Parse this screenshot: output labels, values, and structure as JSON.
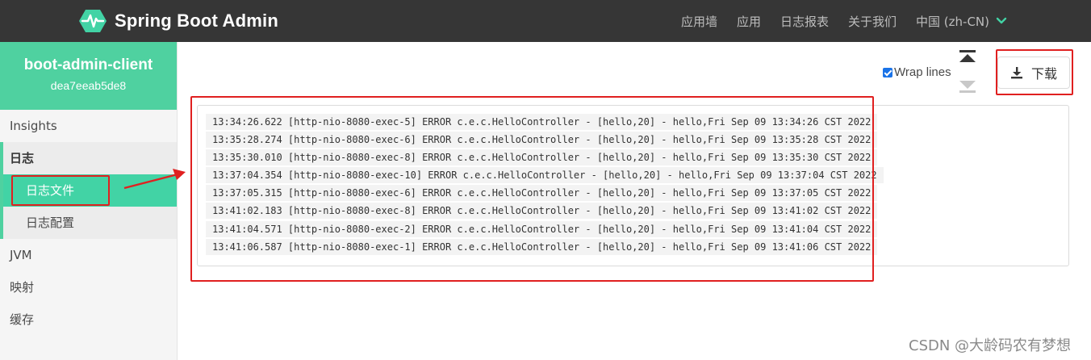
{
  "navbar": {
    "brand": "Spring Boot Admin",
    "items": [
      "应用墙",
      "应用",
      "日志报表",
      "关于我们"
    ],
    "language": "中国 (zh-CN)",
    "accent": "#4fd1a0"
  },
  "sidebar": {
    "app_name": "boot-admin-client",
    "app_id": "dea7eeab5de8",
    "items": {
      "insights": "Insights",
      "log_group": "日志",
      "log_file": "日志文件",
      "log_config": "日志配置",
      "jvm": "JVM",
      "mapping": "映射",
      "cache": "缓存"
    }
  },
  "toolbar": {
    "wrap_lines_label": "Wrap lines",
    "wrap_lines_checked": true,
    "download_label": "下载"
  },
  "log": {
    "lines": [
      "13:34:26.622 [http-nio-8080-exec-5] ERROR c.e.c.HelloController - [hello,20] - hello,Fri Sep 09 13:34:26 CST 2022",
      "13:35:28.274 [http-nio-8080-exec-6] ERROR c.e.c.HelloController - [hello,20] - hello,Fri Sep 09 13:35:28 CST 2022",
      "13:35:30.010 [http-nio-8080-exec-8] ERROR c.e.c.HelloController - [hello,20] - hello,Fri Sep 09 13:35:30 CST 2022",
      "13:37:04.354 [http-nio-8080-exec-10] ERROR c.e.c.HelloController - [hello,20] - hello,Fri Sep 09 13:37:04 CST 2022",
      "13:37:05.315 [http-nio-8080-exec-6] ERROR c.e.c.HelloController - [hello,20] - hello,Fri Sep 09 13:37:05 CST 2022",
      "13:41:02.183 [http-nio-8080-exec-8] ERROR c.e.c.HelloController - [hello,20] - hello,Fri Sep 09 13:41:02 CST 2022",
      "13:41:04.571 [http-nio-8080-exec-2] ERROR c.e.c.HelloController - [hello,20] - hello,Fri Sep 09 13:41:04 CST 2022",
      "13:41:06.587 [http-nio-8080-exec-1] ERROR c.e.c.HelloController - [hello,20] - hello,Fri Sep 09 13:41:06 CST 2022"
    ]
  },
  "watermark": "CSDN @大龄码农有梦想"
}
